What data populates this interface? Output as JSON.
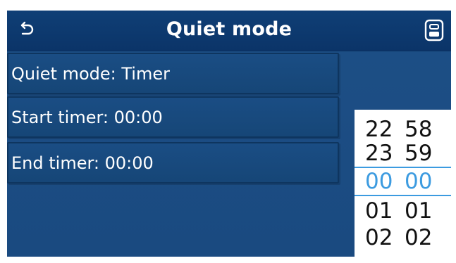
{
  "header": {
    "title": "Quiet mode",
    "back_icon": "back-arrow-icon",
    "save_icon": "save-icon"
  },
  "menu": {
    "items": [
      {
        "label": "Quiet mode: Timer"
      },
      {
        "label": "Start timer: 00:00"
      },
      {
        "label": "End timer: 00:00"
      }
    ]
  },
  "time_picker": {
    "hours": [
      "22",
      "23",
      "00",
      "01",
      "02"
    ],
    "minutes": [
      "58",
      "59",
      "00",
      "01",
      "02"
    ],
    "selected_hour": "00",
    "selected_minute": "00",
    "highlight_color": "#3c9be0"
  },
  "colors": {
    "background": "#1d4f86",
    "header": "#0f3f76",
    "accent": "#3c9be0"
  }
}
